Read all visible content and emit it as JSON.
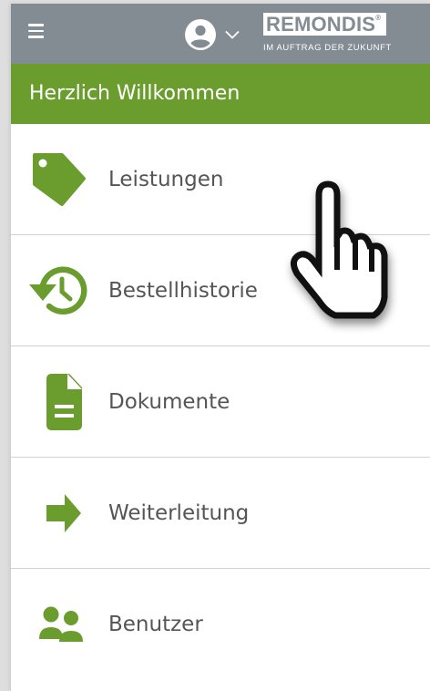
{
  "header": {
    "brand_name": "REMONDIS",
    "brand_registered": "®",
    "brand_tagline": "IM AUFTRAG DER ZUKUNFT",
    "menu_icon": "hamburger-icon",
    "account_icon": "account-circle-icon",
    "account_dropdown_icon": "chevron-down-icon"
  },
  "welcome": {
    "text": "Herzlich Willkommen"
  },
  "menu": {
    "items": [
      {
        "label": "Leistungen",
        "icon": "tag-icon"
      },
      {
        "label": "Bestellhistorie",
        "icon": "history-icon"
      },
      {
        "label": "Dokumente",
        "icon": "document-icon"
      },
      {
        "label": "Weiterleitung",
        "icon": "arrow-right-icon"
      },
      {
        "label": "Benutzer",
        "icon": "users-icon"
      }
    ]
  },
  "colors": {
    "topbar": "#838b93",
    "accent_green": "#6a9d2e",
    "label_text": "#555555",
    "divider": "#d2d2d2"
  }
}
